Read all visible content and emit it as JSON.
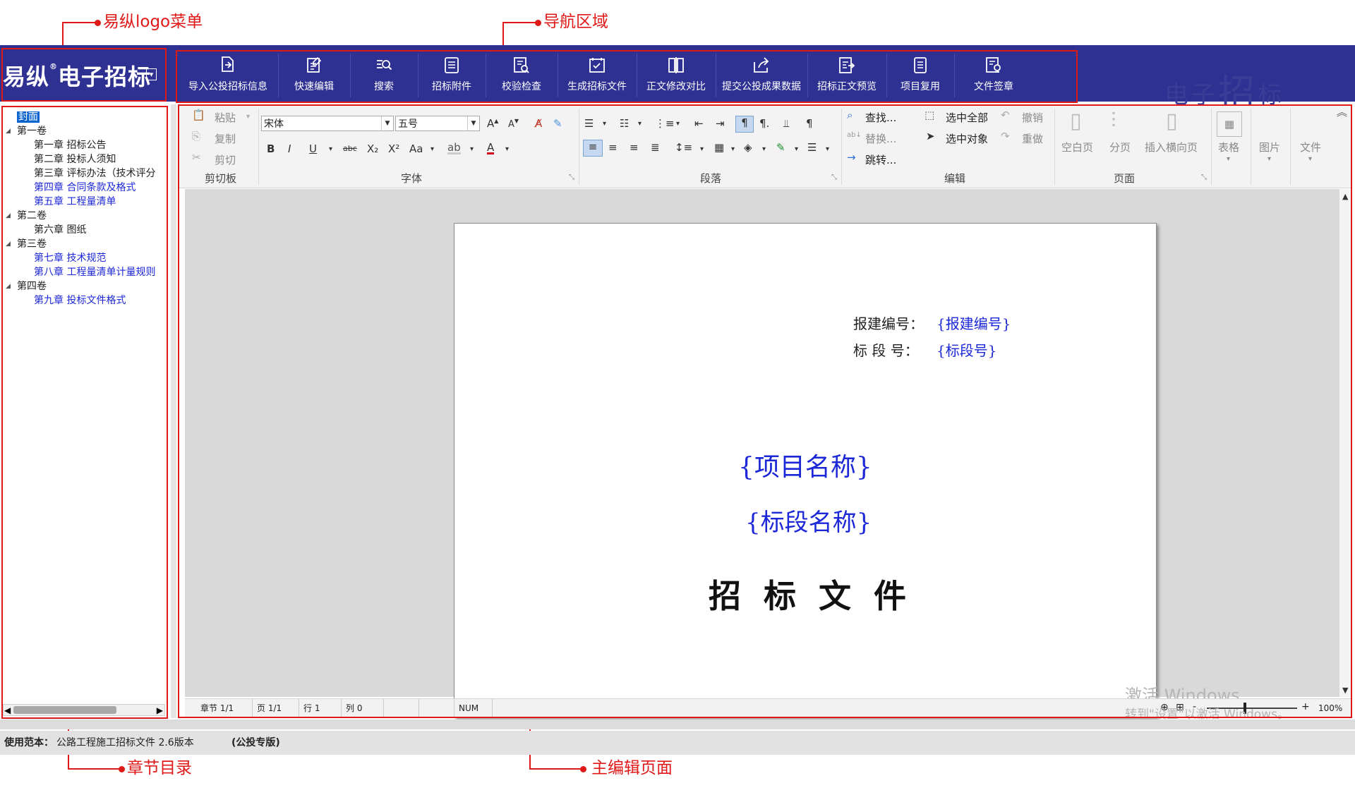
{
  "annotations": {
    "logo_menu": "易纵logo菜单",
    "nav_area": "导航区域",
    "chapter_toc": "章节目录",
    "main_editor": "主编辑页面"
  },
  "app": {
    "logo_text": "易纵",
    "logo_reg": "®",
    "logo_text2": "电子招标",
    "watermark_small1": "电",
    "watermark_small2": "子",
    "watermark_big": "招",
    "watermark_small3": "标"
  },
  "nav": {
    "items": [
      {
        "label": "导入公投招标信息",
        "icon": "document-import-icon"
      },
      {
        "label": "快速编辑",
        "icon": "edit-document-icon"
      },
      {
        "label": "搜索",
        "icon": "search-list-icon"
      },
      {
        "label": "招标附件",
        "icon": "attachment-list-icon"
      },
      {
        "label": "校验检查",
        "icon": "check-search-icon"
      },
      {
        "label": "生成招标文件",
        "icon": "generate-check-icon"
      },
      {
        "label": "正文修改对比",
        "icon": "compare-icon"
      },
      {
        "label": "提交公投成果数据",
        "icon": "share-submit-icon"
      },
      {
        "label": "招标正文预览",
        "icon": "preview-icon"
      },
      {
        "label": "项目复用",
        "icon": "reuse-document-icon"
      },
      {
        "label": "文件签章",
        "icon": "seal-document-icon"
      }
    ]
  },
  "tree": {
    "items": [
      {
        "label": "封面",
        "selected": true
      },
      {
        "label": "第一卷",
        "expanded": true
      },
      {
        "label": "第一章 招标公告"
      },
      {
        "label": "第二章 投标人须知"
      },
      {
        "label": "第三章 评标办法（技术评分"
      },
      {
        "label": "第四章 合同条款及格式"
      },
      {
        "label": "第五章 工程量清单"
      },
      {
        "label": "第二卷",
        "expanded": true
      },
      {
        "label": "第六章 图纸"
      },
      {
        "label": "第三卷",
        "expanded": true
      },
      {
        "label": "第七章 技术规范"
      },
      {
        "label": "第八章 工程量清单计量规则"
      },
      {
        "label": "第四卷",
        "expanded": true
      },
      {
        "label": "第九章 投标文件格式"
      }
    ]
  },
  "ribbon": {
    "clipboard": {
      "paste": "粘贴",
      "copy": "复制",
      "cut": "剪切",
      "group": "剪切板"
    },
    "font": {
      "family": "宋体",
      "size": "五号",
      "group": "字体",
      "bold": "B",
      "italic": "I",
      "underline": "U",
      "strike": "abc",
      "sub": "X₂",
      "sup": "X²",
      "case": "Aa",
      "grow": "A",
      "shrink": "A",
      "color": "A"
    },
    "paragraph": {
      "group": "段落",
      "pilcrow": "¶"
    },
    "editing": {
      "find": "查找...",
      "replace": "替换...",
      "goto": "跳转...",
      "select_all": "选中全部",
      "select_obj": "选中对象",
      "undo": "撤销",
      "redo": "重做",
      "group": "编辑"
    },
    "page": {
      "blank": "空白页",
      "break": "分页",
      "landscape": "插入横向页",
      "group": "页面"
    },
    "table": "表格",
    "picture": "图片",
    "file": "文件"
  },
  "document": {
    "proj_no_label": "报建编号：",
    "proj_no_val": "{报建编号}",
    "section_no_label": "标 段 号：",
    "section_no_val": "{标段号}",
    "project_name": "{项目名称}",
    "section_name": "{标段名称}",
    "doc_title": "招 标 文 件"
  },
  "status": {
    "chapter": "章节 1/1",
    "page": "页 1/1",
    "row": "行 1",
    "col": "列 0",
    "num": "NUM",
    "zoom": "100%",
    "zoom_minus": "-",
    "zoom_plus": "+",
    "win_watermark1": "激活 Windows",
    "win_watermark2": "转到\"设置\"以激活 Windows。"
  },
  "footer": {
    "label": "使用范本：",
    "template": "公路工程施工招标文件  2.6版本",
    "edition": "(公投专版)"
  }
}
